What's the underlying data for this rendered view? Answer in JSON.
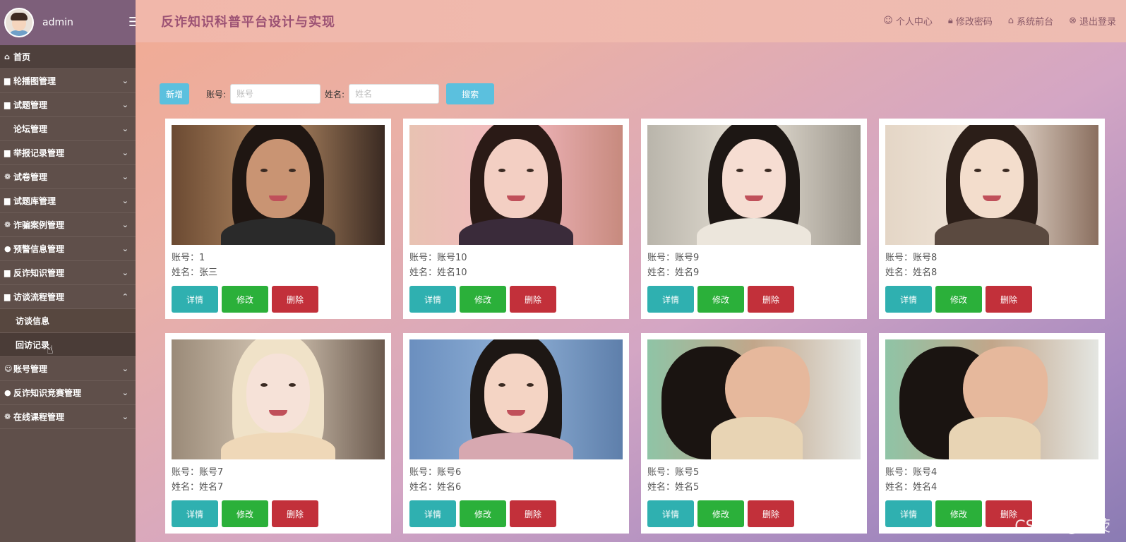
{
  "sidebar": {
    "username": "admin",
    "items": [
      {
        "icon": "⌂",
        "label": "首页"
      },
      {
        "icon": "▆",
        "label": "轮播图管理"
      },
      {
        "icon": "▆",
        "label": "试题管理"
      },
      {
        "icon": "",
        "label": "论坛管理"
      },
      {
        "icon": "▆",
        "label": "举报记录管理"
      },
      {
        "icon": "❁",
        "label": "试卷管理"
      },
      {
        "icon": "▆",
        "label": "试题库管理"
      },
      {
        "icon": "❁",
        "label": "诈骗案例管理"
      },
      {
        "icon": "●",
        "label": "预警信息管理"
      },
      {
        "icon": "▆",
        "label": "反诈知识管理"
      },
      {
        "icon": "▆",
        "label": "访谈流程管理"
      }
    ],
    "sub_items": [
      {
        "label": "访谈信息"
      },
      {
        "label": "回访记录"
      }
    ],
    "items_after": [
      {
        "icon": "☺",
        "label": "账号管理"
      },
      {
        "icon": "●",
        "label": "反诈知识竞赛管理"
      },
      {
        "icon": "❁",
        "label": "在线课程管理"
      }
    ]
  },
  "header": {
    "title": "反诈知识科普平台设计与实现",
    "links": [
      "个人中心",
      "修改密码",
      "系统前台",
      "退出登录"
    ]
  },
  "toolbar": {
    "add_label": "新增",
    "account_label": "账号:",
    "account_placeholder": "账号",
    "name_label": "姓名:",
    "name_placeholder": "姓名",
    "search_label": "搜索"
  },
  "card_labels": {
    "account": "账号：",
    "name": "姓名：",
    "detail": "详情",
    "edit": "修改",
    "delete": "删除"
  },
  "cards": [
    {
      "account": "1",
      "name": "张三"
    },
    {
      "account": "账号10",
      "name": "姓名10"
    },
    {
      "account": "账号9",
      "name": "姓名9"
    },
    {
      "account": "账号8",
      "name": "姓名8"
    },
    {
      "account": "账号7",
      "name": "姓名7"
    },
    {
      "account": "账号6",
      "name": "姓名6"
    },
    {
      "account": "账号5",
      "name": "姓名5"
    },
    {
      "account": "账号4",
      "name": "姓名4"
    }
  ],
  "watermark": "CSDN @杨荧",
  "colors": {
    "sidebar_bg": "#5f4f4a",
    "header_title": "#9c5274",
    "detail_button": "#2fb0b0",
    "edit_button": "#2bb03a",
    "delete_button": "#c2303a",
    "search_button": "#5bc0de"
  }
}
